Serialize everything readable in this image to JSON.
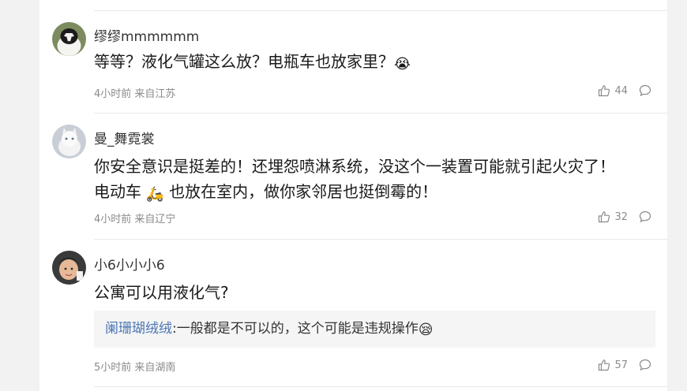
{
  "comments": [
    {
      "username": "缪缪mmmmmm",
      "text": "等等？液化气罐这么放？电瓶车也放家里？",
      "emoji": "😭",
      "time": "4小时前",
      "location": "来自江苏",
      "likes": "44"
    },
    {
      "username": "曼_舞霓裳",
      "text_line1": "你安全意识是挺差的！还埋怨喷淋系统，没这个一装置可能就引起火灾了！",
      "text_line2_before": "电动车",
      "text_line2_emoji": "🛵",
      "text_line2_after": "也放在室内，做你家邻居也挺倒霉的！",
      "time": "4小时前",
      "location": "来自辽宁",
      "likes": "32"
    },
    {
      "username": "小6小小小6",
      "text": "公寓可以用液化气?",
      "reply": {
        "user": "阑珊瑚绒绒",
        "separator": ":",
        "text": "一般都是不可以的，这个可能是违规操作",
        "emoji": "😪"
      },
      "time": "5小时前",
      "location": "来自湖南",
      "likes": "57"
    }
  ],
  "colors": {
    "reply_user": "#4a74b3",
    "meta_text": "#8a8a8a",
    "background": "#f2f2f2"
  }
}
